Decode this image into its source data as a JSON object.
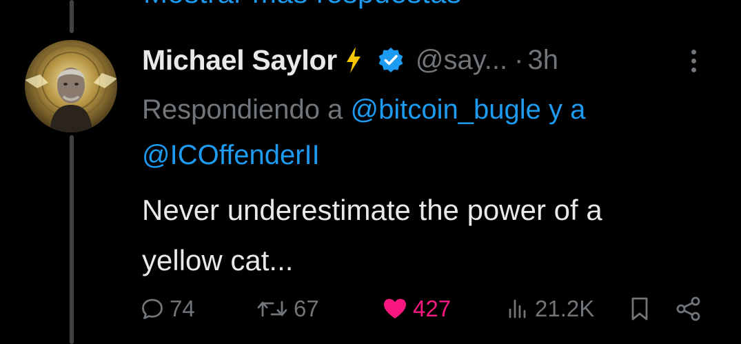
{
  "top_link": {
    "label": "Mostrar más respuestas"
  },
  "tweet": {
    "author": {
      "display_name": "Michael Saylor",
      "handle": "@say...",
      "time": "3h",
      "separator": "·"
    },
    "reply_to": {
      "prefix": "Respondiendo a",
      "mention_1": "@bitcoin_bugle",
      "connector": "y a",
      "mention_2": "@ICOffenderII"
    },
    "text_line_1": "Never underestimate the power of a",
    "text_line_2": "yellow cat...",
    "actions": {
      "replies": "74",
      "reposts": "67",
      "likes": "427",
      "views": "21.2K"
    }
  },
  "colors": {
    "background": "#000000",
    "primary_text": "#e7e9ea",
    "secondary_text": "#71767b",
    "link": "#1d9bf0",
    "like": "#f91880",
    "bolt": "#f7c600",
    "verified": "#1d9bf0",
    "thread_line": "#3f4347"
  },
  "icons": {
    "avatar": "avatar",
    "bolt": "lightning-bolt-icon",
    "verified": "verified-badge-icon",
    "more": "more-options-icon",
    "reply": "reply-icon",
    "repost": "repost-icon",
    "like": "heart-icon",
    "views": "views-icon",
    "bookmark": "bookmark-icon",
    "share": "share-icon"
  }
}
